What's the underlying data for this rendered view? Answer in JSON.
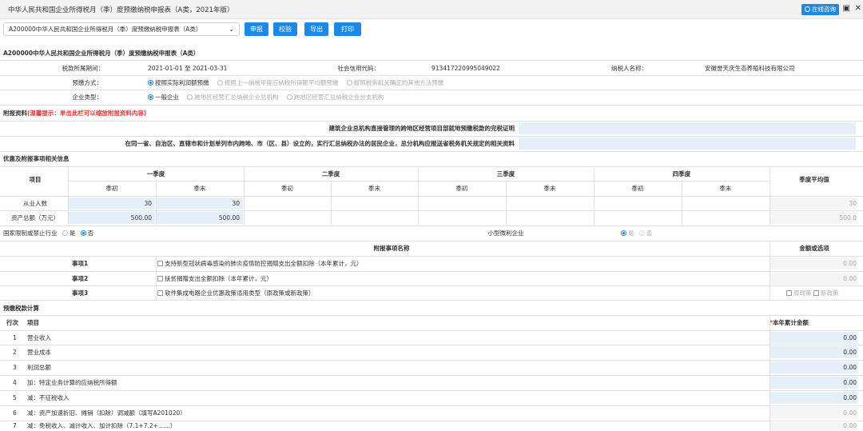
{
  "window": {
    "title": "中华人民共和国企业所得税月（季）度预缴纳税申报表（A类，2021年版）",
    "online_label": "在线咨询"
  },
  "toolbar": {
    "selected_form": "A200000中华人民共和国企业所得税月（季）度预缴纳税申报表（A类）",
    "declare": "申报",
    "verify": "校验",
    "export": "导出",
    "print": "打印"
  },
  "form": {
    "title": "A200000中华人民共和国企业所得税月（季）度预缴纳税申报表（A类）",
    "period_label": "税款所属期间：",
    "period_value": "2021-01-01 至 2021-03-31",
    "credit_label": "社会信用代码：",
    "credit_value": "913417220995049022",
    "taxpayer_label": "纳税人名称：",
    "taxpayer_value": "安徽誉天庆生态养殖科技有限公司",
    "prepay_label": "预缴方式：",
    "prepay_options": [
      "按照实际利润额预缴",
      "按照上一纳税年度应纳税所得额平均额预缴",
      "按照税务机关确定的其他方法预缴"
    ],
    "enterprise_label": "企业类型：",
    "enterprise_options": [
      "一般企业",
      "跨地区经营汇总纳税企业总机构",
      "跨地区经营汇总纳税企业分支机构"
    ]
  },
  "attachment": {
    "header": "附报资料",
    "tip": "(温馨提示：单击此栏可以缩放附报资料内容)",
    "row1": "建筑企业总机构直接管理的跨地区经营项目部就地预缴税款的完税证明",
    "row2": "在同一省、自治区、直辖市和计划单列市内跨地、市（区、县）设立的，实行汇总纳税办法的居民企业，总分机构应报送省税务机关规定的相关资料"
  },
  "preferences": {
    "header": "优惠及附报事项相关信息",
    "item_col": "项目",
    "quarters": [
      "一季度",
      "二季度",
      "三季度",
      "四季度"
    ],
    "sub_cols": [
      "季初",
      "季末"
    ],
    "avg_col": "季度平均值",
    "employees_label": "从业人数",
    "employees_q1": [
      "30",
      "30"
    ],
    "employees_avg": "30",
    "assets_label": "资产总额（万元）",
    "assets_q1": [
      "500.00",
      "500.00"
    ],
    "assets_avg": "500.0",
    "restricted_label": "国家限制或禁止行业",
    "yes": "是",
    "no": "否",
    "small_label": "小型微利企业"
  },
  "items": {
    "name_header": "附报事项名称",
    "amount_header": "金额或选项",
    "rows": [
      {
        "label": "事项1",
        "text": "支持新型冠状病毒感染的肺炎疫情防控捐赠支出全额扣除（本年累计，元）",
        "value": "0.00"
      },
      {
        "label": "事项2",
        "text": "扶贫捐赠支出全额扣除（本年累计，元）",
        "value": "0.00"
      },
      {
        "label": "事项3",
        "text": "软件集成电路企业优惠政策适用类型（原政策或新政策）",
        "opt1": "原政策",
        "opt2": "新政策"
      }
    ]
  },
  "calc": {
    "header": "预缴税款计算",
    "col_line": "行次",
    "col_item": "项目",
    "col_amount": "本年累计金额",
    "required_mark": "*",
    "rows": [
      {
        "no": "1",
        "item": "营业收入",
        "value": "0.00"
      },
      {
        "no": "2",
        "item": "营业成本",
        "value": "0.00"
      },
      {
        "no": "3",
        "item": "利润总额",
        "value": "0.00"
      },
      {
        "no": "4",
        "item": "加：特定业务计算的应纳税所得额",
        "value": "0.00"
      },
      {
        "no": "5",
        "item": "减：不征税收入",
        "value": "0.00"
      },
      {
        "no": "6",
        "item": "减：资产加速折旧、摊销（扣除）调减额（填写A201020）",
        "value": "0.00"
      },
      {
        "no": "7",
        "item": "减：免税收入、减计收入、加计扣除（7.1+7.2+……）",
        "value": "0.00"
      }
    ]
  }
}
